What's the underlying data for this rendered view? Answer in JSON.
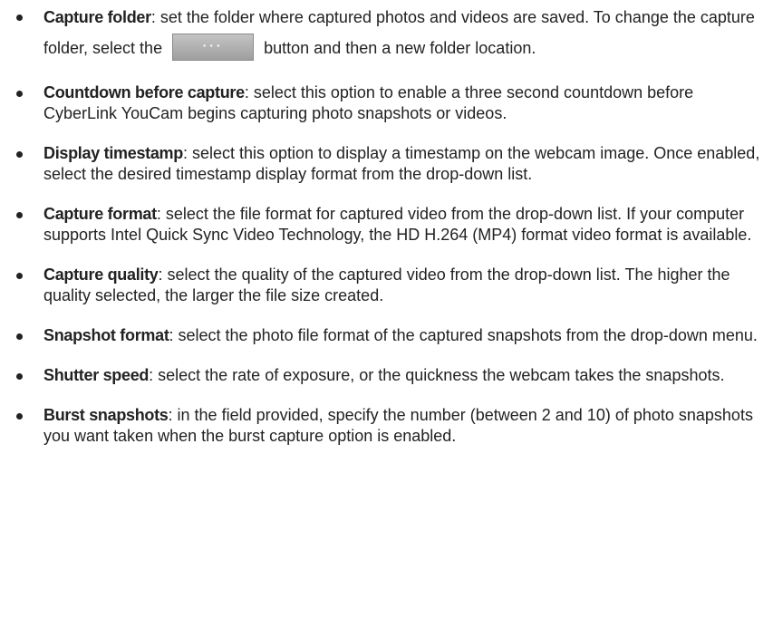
{
  "items": [
    {
      "term": "Capture folder",
      "pre": ": set the folder where captured photos and videos are saved. To change the capture folder, select the",
      "button": "···",
      "post": "button and then a new folder location."
    },
    {
      "term": "Countdown before capture",
      "text": ": select this option to enable a three second countdown before CyberLink YouCam begins capturing photo snapshots or videos."
    },
    {
      "term": "Display timestamp",
      "text": ": select this option to display a timestamp on the webcam image. Once enabled, select the desired timestamp display format from the drop-down list."
    },
    {
      "term": "Capture format",
      "text": ": select the file format for captured video from the drop-down list. If your computer supports Intel Quick Sync Video Technology, the HD H.264 (MP4) format video format is available."
    },
    {
      "term": "Capture quality",
      "text": ": select the quality of the captured video from the drop-down list. The higher the quality selected, the larger the file size created."
    },
    {
      "term": "Snapshot format",
      "text": ": select the photo file format of the captured snapshots from the drop-down menu."
    },
    {
      "term": "Shutter speed",
      "text": ": select the rate of exposure, or the quickness the webcam takes the snapshots."
    },
    {
      "term": "Burst snapshots",
      "text": ": in the field provided, specify the number (between 2 and 10) of photo snapshots you want taken when the burst capture option is enabled."
    }
  ]
}
